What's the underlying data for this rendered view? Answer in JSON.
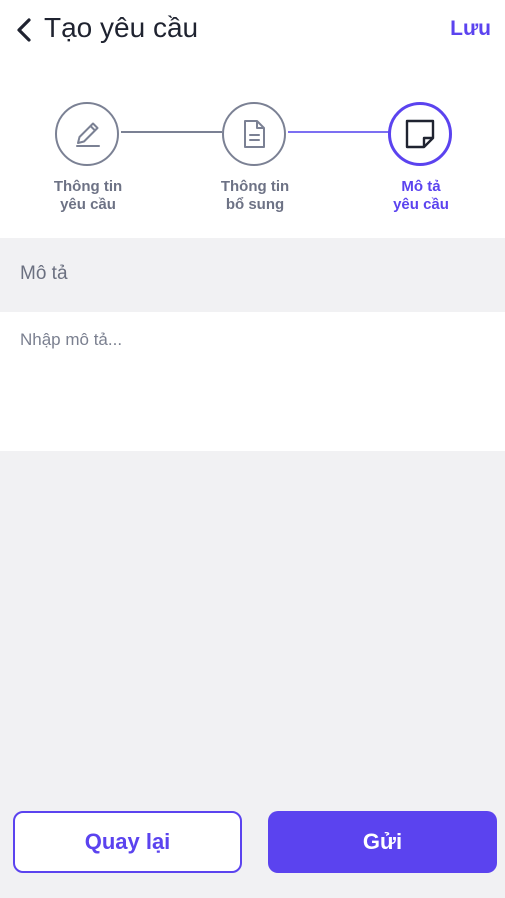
{
  "header": {
    "title": "Tạo yêu cầu",
    "save_label": "Lưu"
  },
  "steps": [
    {
      "line1": "Thông tin",
      "line2": "yêu cầu",
      "icon": "pencil-icon",
      "active": false
    },
    {
      "line1": "Thông tin",
      "line2": "bổ sung",
      "icon": "document-icon",
      "active": false
    },
    {
      "line1": "Mô tả",
      "line2": "yêu cầu",
      "icon": "note-icon",
      "active": true
    }
  ],
  "description": {
    "label": "Mô tả",
    "placeholder": "Nhập mô tả...",
    "value": ""
  },
  "footer": {
    "back_label": "Quay lại",
    "send_label": "Gửi"
  },
  "colors": {
    "accent": "#5b43ef",
    "inactive": "#7b8194",
    "background": "#f1f1f3"
  }
}
